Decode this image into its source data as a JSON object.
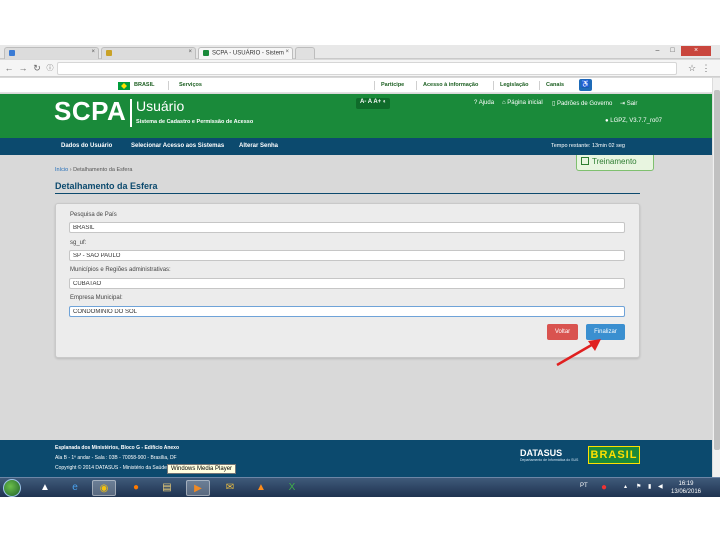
{
  "browser": {
    "tabs": [
      {
        "label": "",
        "active": false
      },
      {
        "label": "",
        "active": false
      },
      {
        "label": "SCPA - USUÁRIO - Sistem",
        "active": true
      }
    ],
    "url": "",
    "window_controls": [
      "–",
      "□",
      "×"
    ]
  },
  "gov_bar": {
    "brasil": "BRASIL",
    "servicos": "Serviços",
    "participe": "Participe",
    "acesso_informacao": "Acesso à informação",
    "legislacao": "Legislação",
    "canais": "Canais"
  },
  "header": {
    "logo": "SCPA",
    "subtitle": "Usuário",
    "description": "Sistema de Cadastro e Permissão de Acesso",
    "font_controls": "A-  A  A+ ◐",
    "links": [
      "Ajuda",
      "Página inicial",
      "Padrões de Governo",
      "Sair"
    ],
    "user_info": "LGPZ, V3.7.7_ro07"
  },
  "menu": {
    "items": [
      "Dados do Usuário",
      "Selecionar Acesso aos Sistemas",
      "Alterar Senha"
    ],
    "timer": "Tempo restante: 13min 02 seg"
  },
  "training_badge": "Treinamento",
  "breadcrumb": {
    "home": "Início",
    "sep": "›",
    "current": "Detalhamento da Esfera"
  },
  "page_title": "Detalhamento da Esfera",
  "form": {
    "fields": [
      {
        "label": "Pesquisa de País",
        "value": "BRASIL"
      },
      {
        "label": "sg_uf:",
        "value": "SP - SAO PAULO"
      },
      {
        "label": "Municípios e Regiões administrativas:",
        "value": "CUBATAO"
      },
      {
        "label": "Empresa Municipal:",
        "value": "CONDOMINIO DO SOL"
      }
    ],
    "back_label": "Voltar",
    "finish_label": "Finalizar"
  },
  "footer": {
    "line1": "Esplanada dos Ministérios, Bloco G - Edifício Anexo",
    "line2": "Ala B - 1º andar - Sala : 03B - 70058-900 - Brasília, DF",
    "line3": "Copyright © 2014 DATASUS - Ministério da Saúde",
    "datasus": "DATASUS",
    "datasus_sub": "Departamento de Informática do SUS",
    "brasil_logo": "BRASIL"
  },
  "tooltip": "Windows Media Player",
  "taskbar": {
    "lang": "PT",
    "clock_time": "16:19",
    "clock_date": "13/06/2016"
  },
  "colors": {
    "header_green": "#1a8a3a",
    "menu_blue": "#0c4a6e",
    "back_red": "#d9534f",
    "finish_blue": "#3a8fd0",
    "arrow_red": "#e02020"
  }
}
